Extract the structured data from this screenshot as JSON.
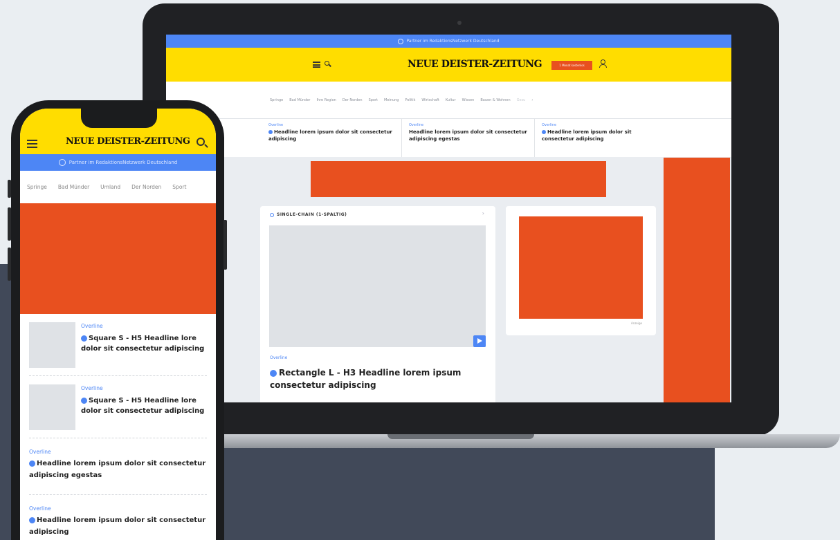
{
  "laptop": {
    "partner_bar": "Partner im RedaktionsNetzwerk Deutschland",
    "logo": "NEUE DEISTER-ZEITUNG",
    "cta_button": "1 Monat kostenlos",
    "nav": [
      "Springe",
      "Bad Münder",
      "Ihre Region",
      "Der Norden",
      "Sport",
      "Meinung",
      "Politik",
      "Wirtschaft",
      "Kultur",
      "Wissen",
      "Bauen & Wohnen",
      "Gesu",
      "›"
    ],
    "top_teasers": [
      {
        "overline": "Overline",
        "headline": "Headline lorem ipsum dolor sit consectetur adipiscing",
        "bullet": true
      },
      {
        "overline": "Overline",
        "headline": "Headline lorem ipsum dolor sit consectetur adipiscing egestas",
        "bullet": false
      },
      {
        "overline": "Overline",
        "headline": "Headline lorem ipsum dolor sit consectetur adipiscing",
        "bullet": true
      }
    ],
    "chain": {
      "title": "SINGLE-CHAIN (1-SPALTIG)",
      "arrow": "›",
      "overline": "Overline",
      "headline": "Rectangle L - H3 Headline lorem ipsum consectetur adipiscing"
    },
    "ad_label": "Anzeige"
  },
  "phone": {
    "logo": "NEUE DEISTER-ZEITUNG",
    "partner_bar": "Partner im RedaktionsNetzwerk Deutschland",
    "nav": [
      "Springe",
      "Bad Münder",
      "Umland",
      "Der Norden",
      "Sport"
    ],
    "items": [
      {
        "overline": "Overline",
        "headline": "Square S - H5 Headline lore dolor sit consectetur adipiscing"
      },
      {
        "overline": "Overline",
        "headline": "Square S - H5 Headline lore dolor sit consectetur adipiscing"
      },
      {
        "overline": "Overline",
        "headline": "Headline lorem ipsum dolor sit consectetur adipiscing egestas"
      },
      {
        "overline": "Overline",
        "headline": "Headline lorem ipsum dolor sit consectetur adipiscing"
      }
    ]
  },
  "colors": {
    "brand_yellow": "#ffdd00",
    "accent_blue": "#4d86f5",
    "ad_orange": "#e8501f",
    "backdrop_dark": "#414959"
  },
  "icons": [
    "menu-icon",
    "search-icon",
    "user-icon",
    "play-icon",
    "partner-logo-icon"
  ]
}
